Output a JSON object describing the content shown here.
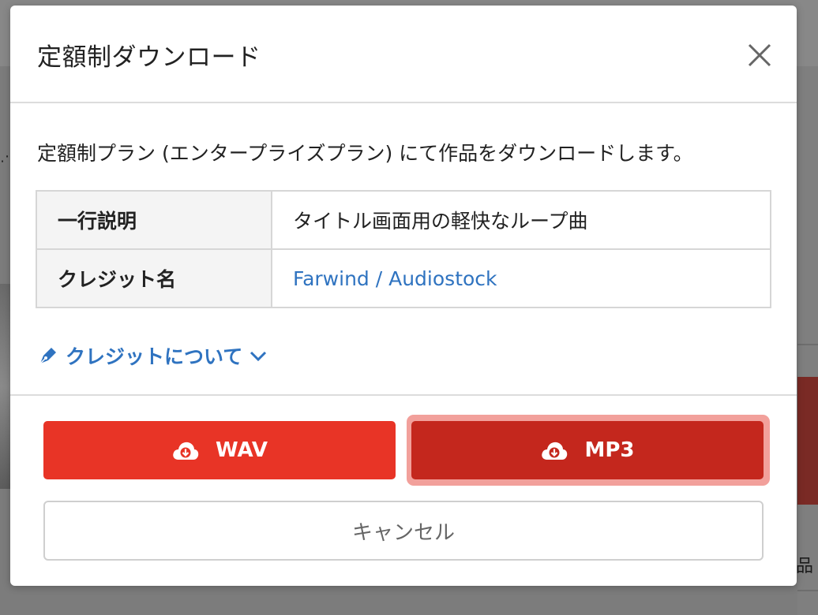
{
  "background": {
    "partial_text": "品"
  },
  "modal": {
    "title": "定額制ダウンロード",
    "intro": "定額制プラン (エンタープライズプラン) にて作品をダウンロードします。",
    "table": {
      "rows": [
        {
          "label": "一行説明",
          "value": "タイトル画面用の軽快なループ曲"
        },
        {
          "label": "クレジット名",
          "value": "Farwind / Audiostock"
        }
      ]
    },
    "credit_about_label": "クレジットについて",
    "buttons": {
      "wav": "WAV",
      "mp3": "MP3",
      "cancel": "キャンセル"
    },
    "icons": {
      "close": "close-icon",
      "pen": "pen-icon",
      "chevron": "chevron-down-icon",
      "cloud_download": "cloud-download-icon"
    }
  },
  "colors": {
    "primary_red": "#e83426",
    "active_red": "#c4271d",
    "link_blue": "#2f73c0"
  }
}
